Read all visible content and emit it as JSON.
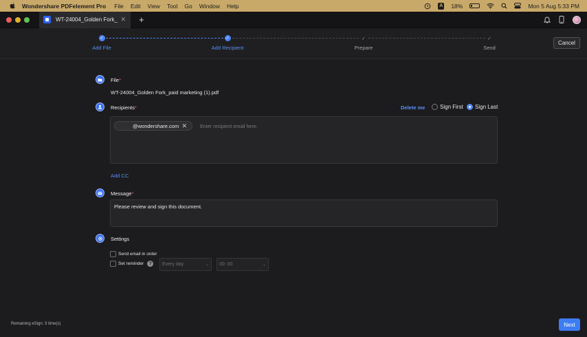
{
  "menubar": {
    "app_name": "Wondershare PDFelement Pro",
    "menus": [
      "File",
      "Edit",
      "View",
      "Tool",
      "Go",
      "Window",
      "Help"
    ],
    "input_source": "A",
    "battery": "18%",
    "battery_level": 0.18,
    "datetime": "Mon 5 Aug  5:33 PM"
  },
  "tabbar": {
    "tab_title": "WT-24004_Golden Fork_...",
    "new_tab": "+"
  },
  "stepper": {
    "steps": [
      {
        "label": "Add File",
        "state": "done"
      },
      {
        "label": "Add Recipient",
        "state": "done"
      },
      {
        "label": "Prepare",
        "state": "todo"
      },
      {
        "label": "Send",
        "state": "todo"
      }
    ],
    "cancel_label": "Cancel"
  },
  "file_section": {
    "label": "File",
    "required_mark": "*",
    "filename": "WT-24004_Golden Fork_paid marketing (1).pdf"
  },
  "recipients_section": {
    "label": "Recipients",
    "required_mark": "*",
    "delete_me": "Delete me",
    "sign_first": "Sign First",
    "sign_last": "Sign Last",
    "selected_order": "Sign Last",
    "chip_email": "@wondershare.com",
    "placeholder": "Enter recipient email here.",
    "add_cc": "Add CC"
  },
  "message_section": {
    "label": "Message",
    "required_mark": "*",
    "text": "Please review and sign this document."
  },
  "settings_section": {
    "label": "Settings",
    "send_in_order": "Send email in order",
    "set_reminder": "Set reminder",
    "help_glyph": "?",
    "frequency_value": "Every day",
    "time_value": "00: 00"
  },
  "footer": {
    "remaining": "Remaining eSign: 3 time(s)",
    "next_label": "Next"
  },
  "colors": {
    "accent": "#3d7cf5",
    "menubar": "#c9a96a",
    "background": "#1c1c1e",
    "required": "#f25a5a"
  }
}
